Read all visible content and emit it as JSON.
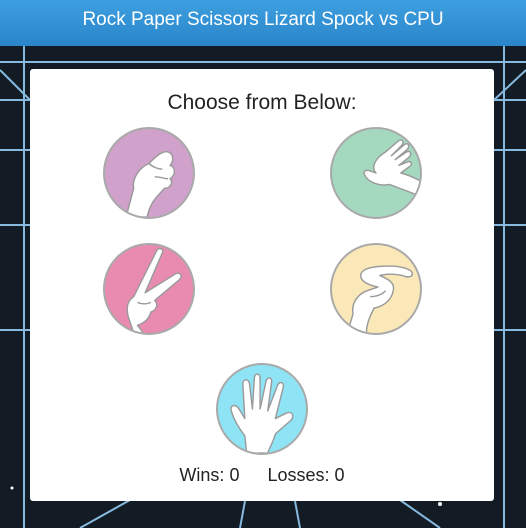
{
  "header": {
    "title": "Rock Paper Scissors Lizard Spock vs CPU"
  },
  "card": {
    "title": "Choose from Below:"
  },
  "choices": [
    {
      "icon": "rock-hand-icon",
      "color": "#cfa1cb"
    },
    {
      "icon": "paper-hand-icon",
      "color": "#a4d8bf"
    },
    {
      "icon": "scissors-hand-icon",
      "color": "#e98bb1"
    },
    {
      "icon": "lizard-hand-icon",
      "color": "#fbe8b9"
    },
    {
      "icon": "spock-hand-icon",
      "color": "#8ee3f4"
    }
  ],
  "score": {
    "wins_label": "Wins:",
    "wins": "0",
    "losses_label": "Losses:",
    "losses": "0"
  }
}
